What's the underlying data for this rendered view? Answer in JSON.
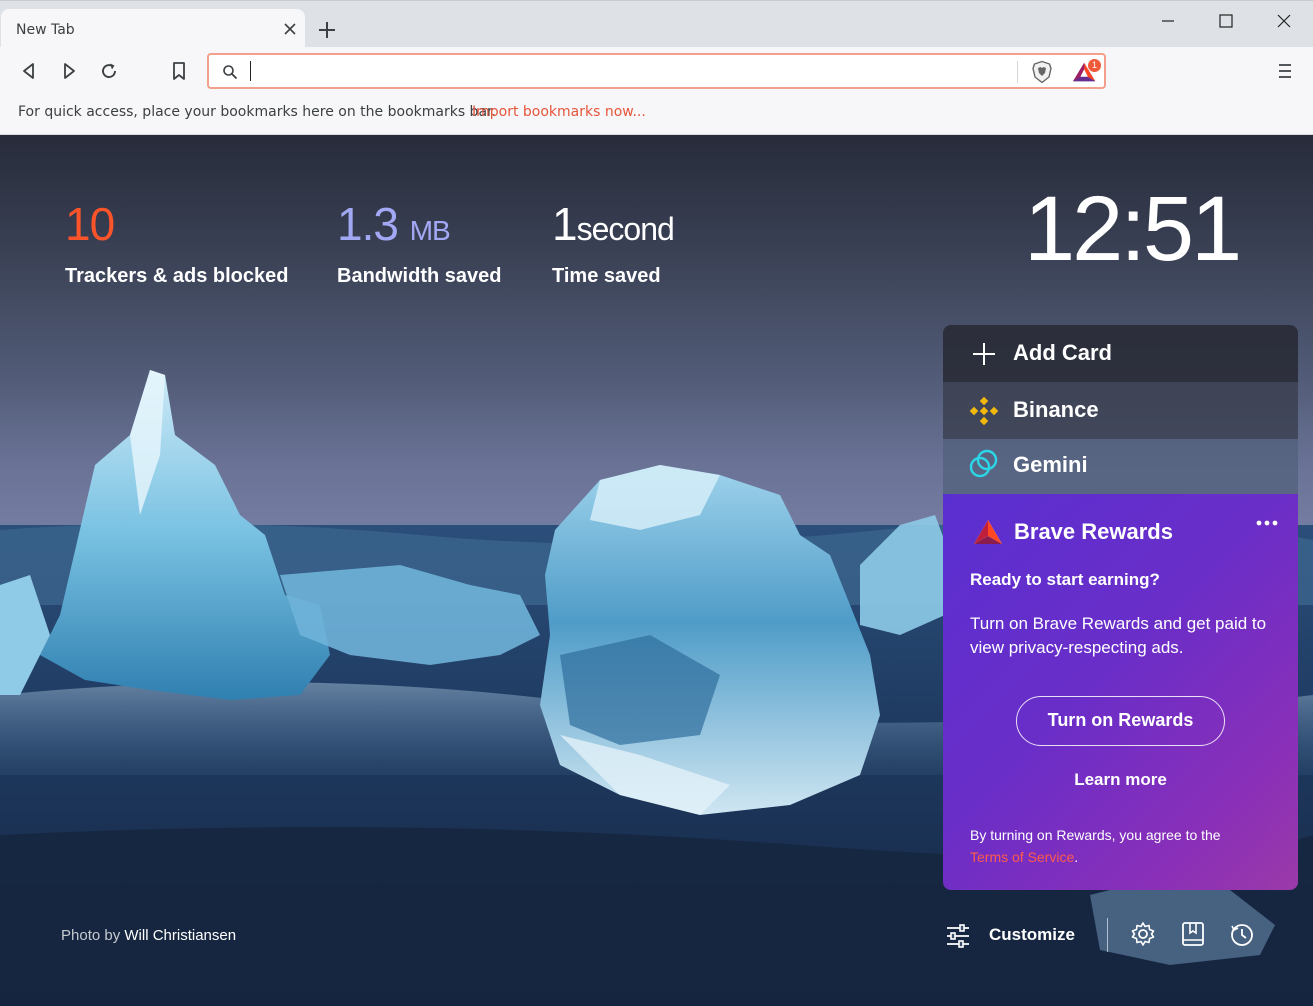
{
  "tab": {
    "title": "New Tab"
  },
  "toolbar": {
    "address_value": ""
  },
  "bookmarks_bar": {
    "message": "For quick access, place your bookmarks here on the bookmarks bar.",
    "import_link": "Import bookmarks now..."
  },
  "notification_badge": "1",
  "stats": [
    {
      "value": "10",
      "unit": "",
      "label": "Trackers & ads blocked",
      "color": "#fb542b"
    },
    {
      "value": "1.3",
      "unit": "MB",
      "label": "Bandwidth saved",
      "color": "#a3a8f5"
    },
    {
      "value": "1",
      "unit": "second",
      "label": "Time saved",
      "color": "#ffffff"
    }
  ],
  "clock": "12:51",
  "cards": {
    "add_card": "Add Card",
    "binance": "Binance",
    "gemini": "Gemini"
  },
  "rewards": {
    "title": "Brave Rewards",
    "heading": "Ready to start earning?",
    "body": "Turn on Brave Rewards and get paid to view privacy-respecting ads.",
    "button": "Turn on Rewards",
    "learn_more": "Learn more",
    "terms_prefix": "By turning on Rewards, you agree to the",
    "terms_link": "Terms of Service",
    "terms_suffix": "."
  },
  "footer": {
    "photo_by": "Photo by",
    "photo_author": "Will Christiansen",
    "customize": "Customize"
  },
  "icons": {
    "tab_close": "close-icon",
    "new_tab": "plus-icon",
    "back": "back-icon",
    "forward": "forward-icon",
    "reload": "reload-icon",
    "bookmark": "bookmark-icon",
    "search": "search-icon",
    "shields": "brave-shield-icon",
    "rewards": "bat-rewards-icon",
    "menu": "hamburger-menu-icon",
    "add": "plus-icon",
    "binance": "binance-logo-icon",
    "gemini": "gemini-logo-icon",
    "more": "more-horizontal-icon",
    "customize": "sliders-icon",
    "settings": "gear-icon",
    "bookmarks": "bookmarks-icon",
    "history": "history-icon"
  },
  "colors": {
    "brave_orange": "#fb542b",
    "rewards_purple": "#5a2fd1",
    "link_red": "#e5553a"
  }
}
